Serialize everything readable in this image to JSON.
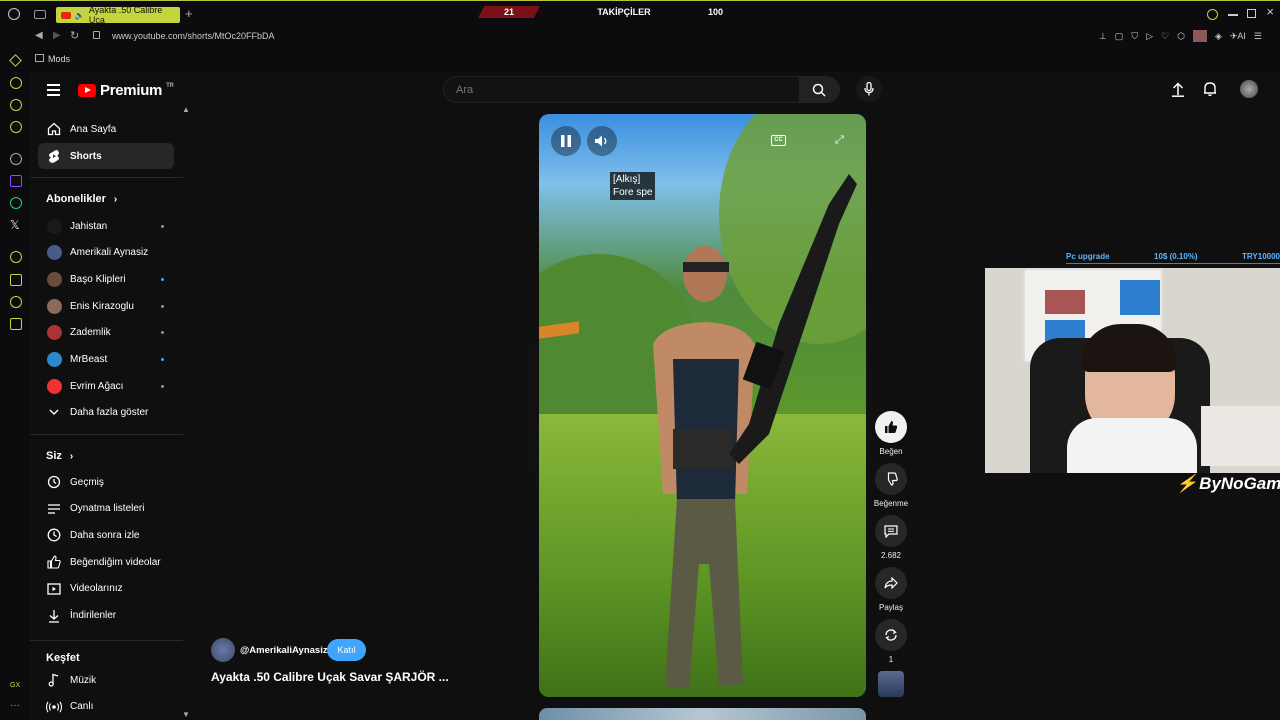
{
  "browser": {
    "tab_title": "Ayakta .50 Calibre Uça",
    "url": "www.youtube.com/shorts/MtOc20FFbDA",
    "bookmark_label": "Mods",
    "gx_label": "GX",
    "ai_label": "AI"
  },
  "stream": {
    "left_count": "21",
    "center_label": "TAKİPÇİLER",
    "right_count": "100",
    "goal_label": "Pc upgrade",
    "goal_progress": "10$ (0.10%)",
    "goal_target": "TRY10000",
    "brand": "ByNoGame"
  },
  "youtube": {
    "logo_text": "Premium",
    "region": "TR",
    "search_placeholder": "Ara"
  },
  "sidebar": {
    "main": [
      {
        "label": "Ana Sayfa",
        "icon": "home-icon"
      },
      {
        "label": "Shorts",
        "icon": "shorts-icon"
      }
    ],
    "subscriptions_title": "Abonelikler",
    "subscriptions": [
      {
        "label": "Jahistan",
        "dot": true,
        "color": "#1a1a1a"
      },
      {
        "label": "Amerikali Aynasiz",
        "dot": false,
        "color": "#4a5a8a"
      },
      {
        "label": "Başo Klipleri",
        "dot": true,
        "color": "#6b4b3a"
      },
      {
        "label": "Enis Kirazoglu",
        "dot": true,
        "color": "#8a6a5a"
      },
      {
        "label": "Zademlik",
        "dot": true,
        "color": "#a33"
      },
      {
        "label": "MrBeast",
        "dot": true,
        "color": "#2a8ad0"
      },
      {
        "label": "Evrim Ağacı",
        "dot": true,
        "color": "#e33"
      }
    ],
    "show_more": "Daha fazla göster",
    "you_title": "Siz",
    "you": [
      {
        "label": "Geçmiş",
        "icon": "history-icon"
      },
      {
        "label": "Oynatma listeleri",
        "icon": "playlists-icon"
      },
      {
        "label": "Daha sonra izle",
        "icon": "watch-later-icon"
      },
      {
        "label": "Beğendiğim videolar",
        "icon": "liked-icon"
      },
      {
        "label": "Videolarınız",
        "icon": "your-videos-icon"
      },
      {
        "label": "İndirilenler",
        "icon": "downloads-icon"
      }
    ],
    "explore_title": "Keşfet",
    "explore": [
      {
        "label": "Müzik",
        "icon": "music-icon"
      },
      {
        "label": "Canlı",
        "icon": "live-icon"
      }
    ]
  },
  "short": {
    "caption_line1": "[Alkış]",
    "caption_line2": "Fore spe",
    "channel": "@AmerikaliAynasiz",
    "join_label": "Katıl",
    "title": "Ayakta .50 Calibre Uçak Savar ŞARJÖR ...",
    "like_label": "Beğen",
    "dislike_label": "Beğenme",
    "comments": "2.682",
    "share_label": "Paylaş",
    "remix_count": "1"
  }
}
